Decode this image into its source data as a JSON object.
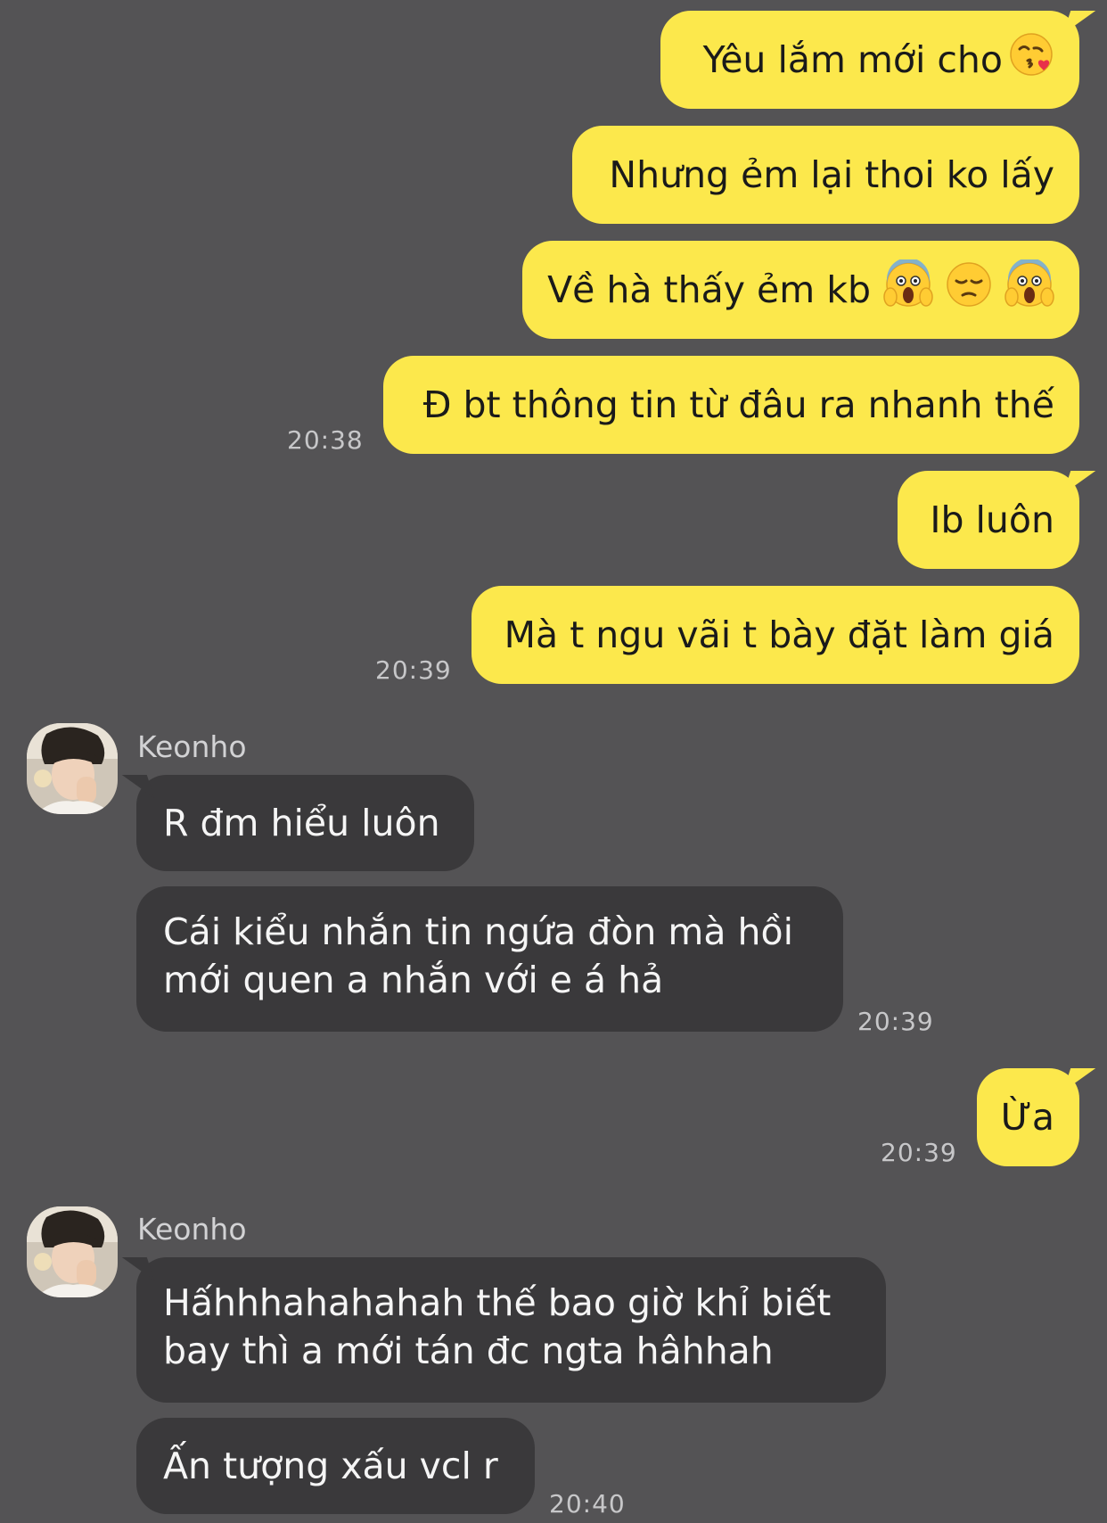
{
  "messages": {
    "m1": {
      "text": "Yêu lắm mới cho"
    },
    "m2": {
      "text": "Nhưng ẻm lại thoi ko lấy"
    },
    "m3": {
      "text": "Về hà thấy ẻm kb"
    },
    "m4": {
      "text": "Đ bt thông tin từ đâu ra nhanh thế",
      "time": "20:38"
    },
    "m5": {
      "text": "Ib luôn"
    },
    "m6": {
      "text": "Mà t ngu vãi t bày đặt làm giá",
      "time": "20:39"
    },
    "m7": {
      "sender": "Keonho",
      "text": "R đm hiểu luôn"
    },
    "m8": {
      "text": "Cái kiểu nhắn tin ngứa đòn mà hồi mới quen a nhắn với e á hả",
      "time": "20:39"
    },
    "m9": {
      "text": "Ừa",
      "time": "20:39"
    },
    "m10": {
      "sender": "Keonho",
      "text": "Hấhhhahahahah thế bao giờ khỉ biết bay thì a mới tán đc ngta hâhhah"
    },
    "m11": {
      "text": "Ấn tượng xấu vcl r",
      "time": "20:40"
    }
  },
  "icons": {
    "kiss": "face-blowing-kiss-icon",
    "scream": "face-screaming-icon",
    "pensive": "pensive-face-icon"
  },
  "colors": {
    "background": "#545355",
    "outgoing_bubble": "#FCE84C",
    "incoming_bubble": "#3A393B"
  }
}
